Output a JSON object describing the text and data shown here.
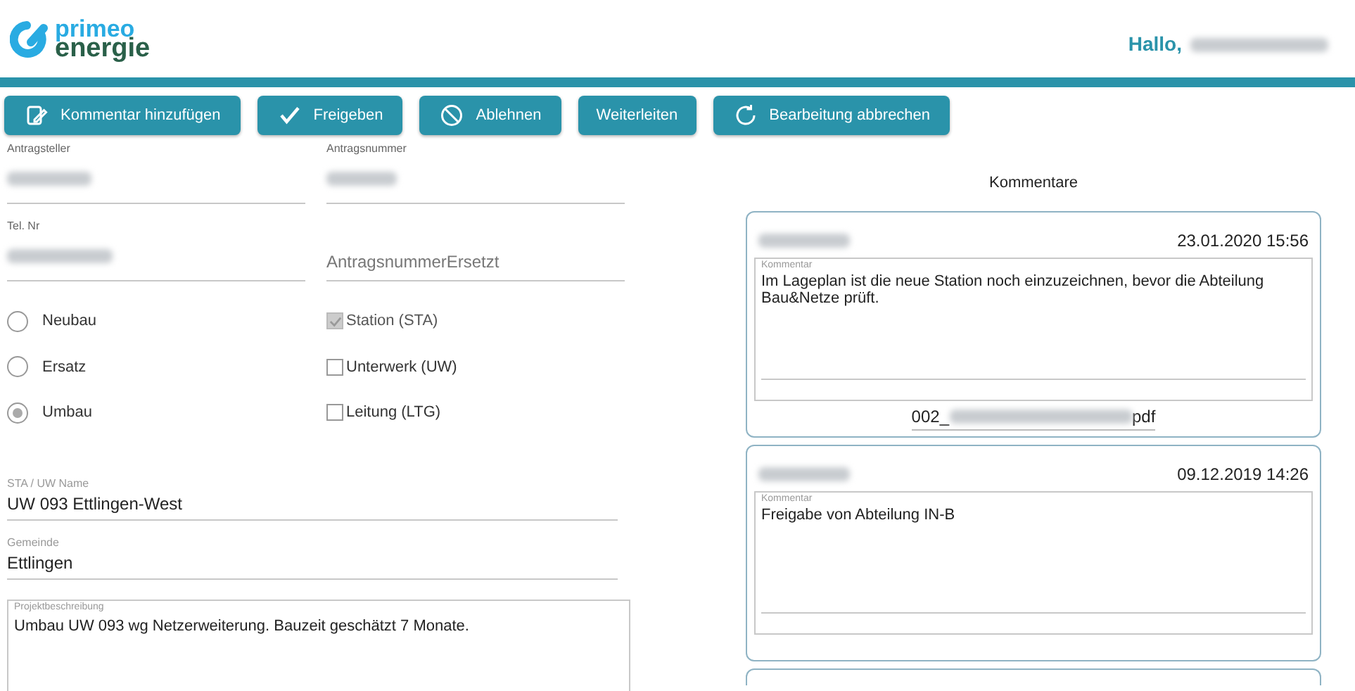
{
  "header": {
    "logo_top": "primeo",
    "logo_bottom": "energie",
    "greeting": "Hallo,",
    "user_blurred": true
  },
  "toolbar": [
    {
      "kind": "comment",
      "label": "Kommentar hinzufügen"
    },
    {
      "kind": "check",
      "label": "Freigeben"
    },
    {
      "kind": "block",
      "label": "Ablehnen"
    },
    {
      "kind": "none",
      "label": "Weiterleiten"
    },
    {
      "kind": "undo",
      "label": "Bearbeitung abbrechen"
    }
  ],
  "fields": [
    {
      "label": "Antragsteller",
      "blurred": true
    },
    {
      "label": "Antragsnummer",
      "blurred": true
    },
    {
      "label": "Tel. Nr",
      "blurred": true
    },
    {
      "placeholder": "AntragsnummerErsetzt"
    }
  ],
  "radios": [
    {
      "label": "Neubau",
      "selected": false
    },
    {
      "label": "Ersatz",
      "selected": false
    },
    {
      "label": "Umbau",
      "selected": true
    }
  ],
  "checkboxes": [
    {
      "label": "Station (STA)",
      "checked": true,
      "disabled": true
    },
    {
      "label": "Unterwerk (UW)",
      "checked": false,
      "disabled": false
    },
    {
      "label": "Leitung (LTG)",
      "checked": false,
      "disabled": false
    }
  ],
  "name_field": {
    "label": "STA / UW Name",
    "value": "UW 093 Ettlingen-West"
  },
  "town_field": {
    "label": "Gemeinde",
    "value": "Ettlingen"
  },
  "description": {
    "label": "Projektbeschreibung",
    "value": "Umbau UW 093 wg Netzerweiterung. Bauzeit geschätzt 7 Monate."
  },
  "comments_title": "Kommentare",
  "comments": [
    {
      "author_blurred": true,
      "date": "23.01.2020 15:56",
      "label": "Kommentar",
      "text": "Im Lageplan ist die neue Station noch einzuzeichnen, bevor die Abteilung Bau&Netze prüft.",
      "attachment": {
        "prefix": "002_",
        "suffix": "pdf"
      }
    },
    {
      "author_blurred": true,
      "date": "09.12.2019 14:26",
      "label": "Kommentar",
      "text": "Freigabe von Abteilung IN-B"
    },
    {
      "cut_off": true
    }
  ]
}
